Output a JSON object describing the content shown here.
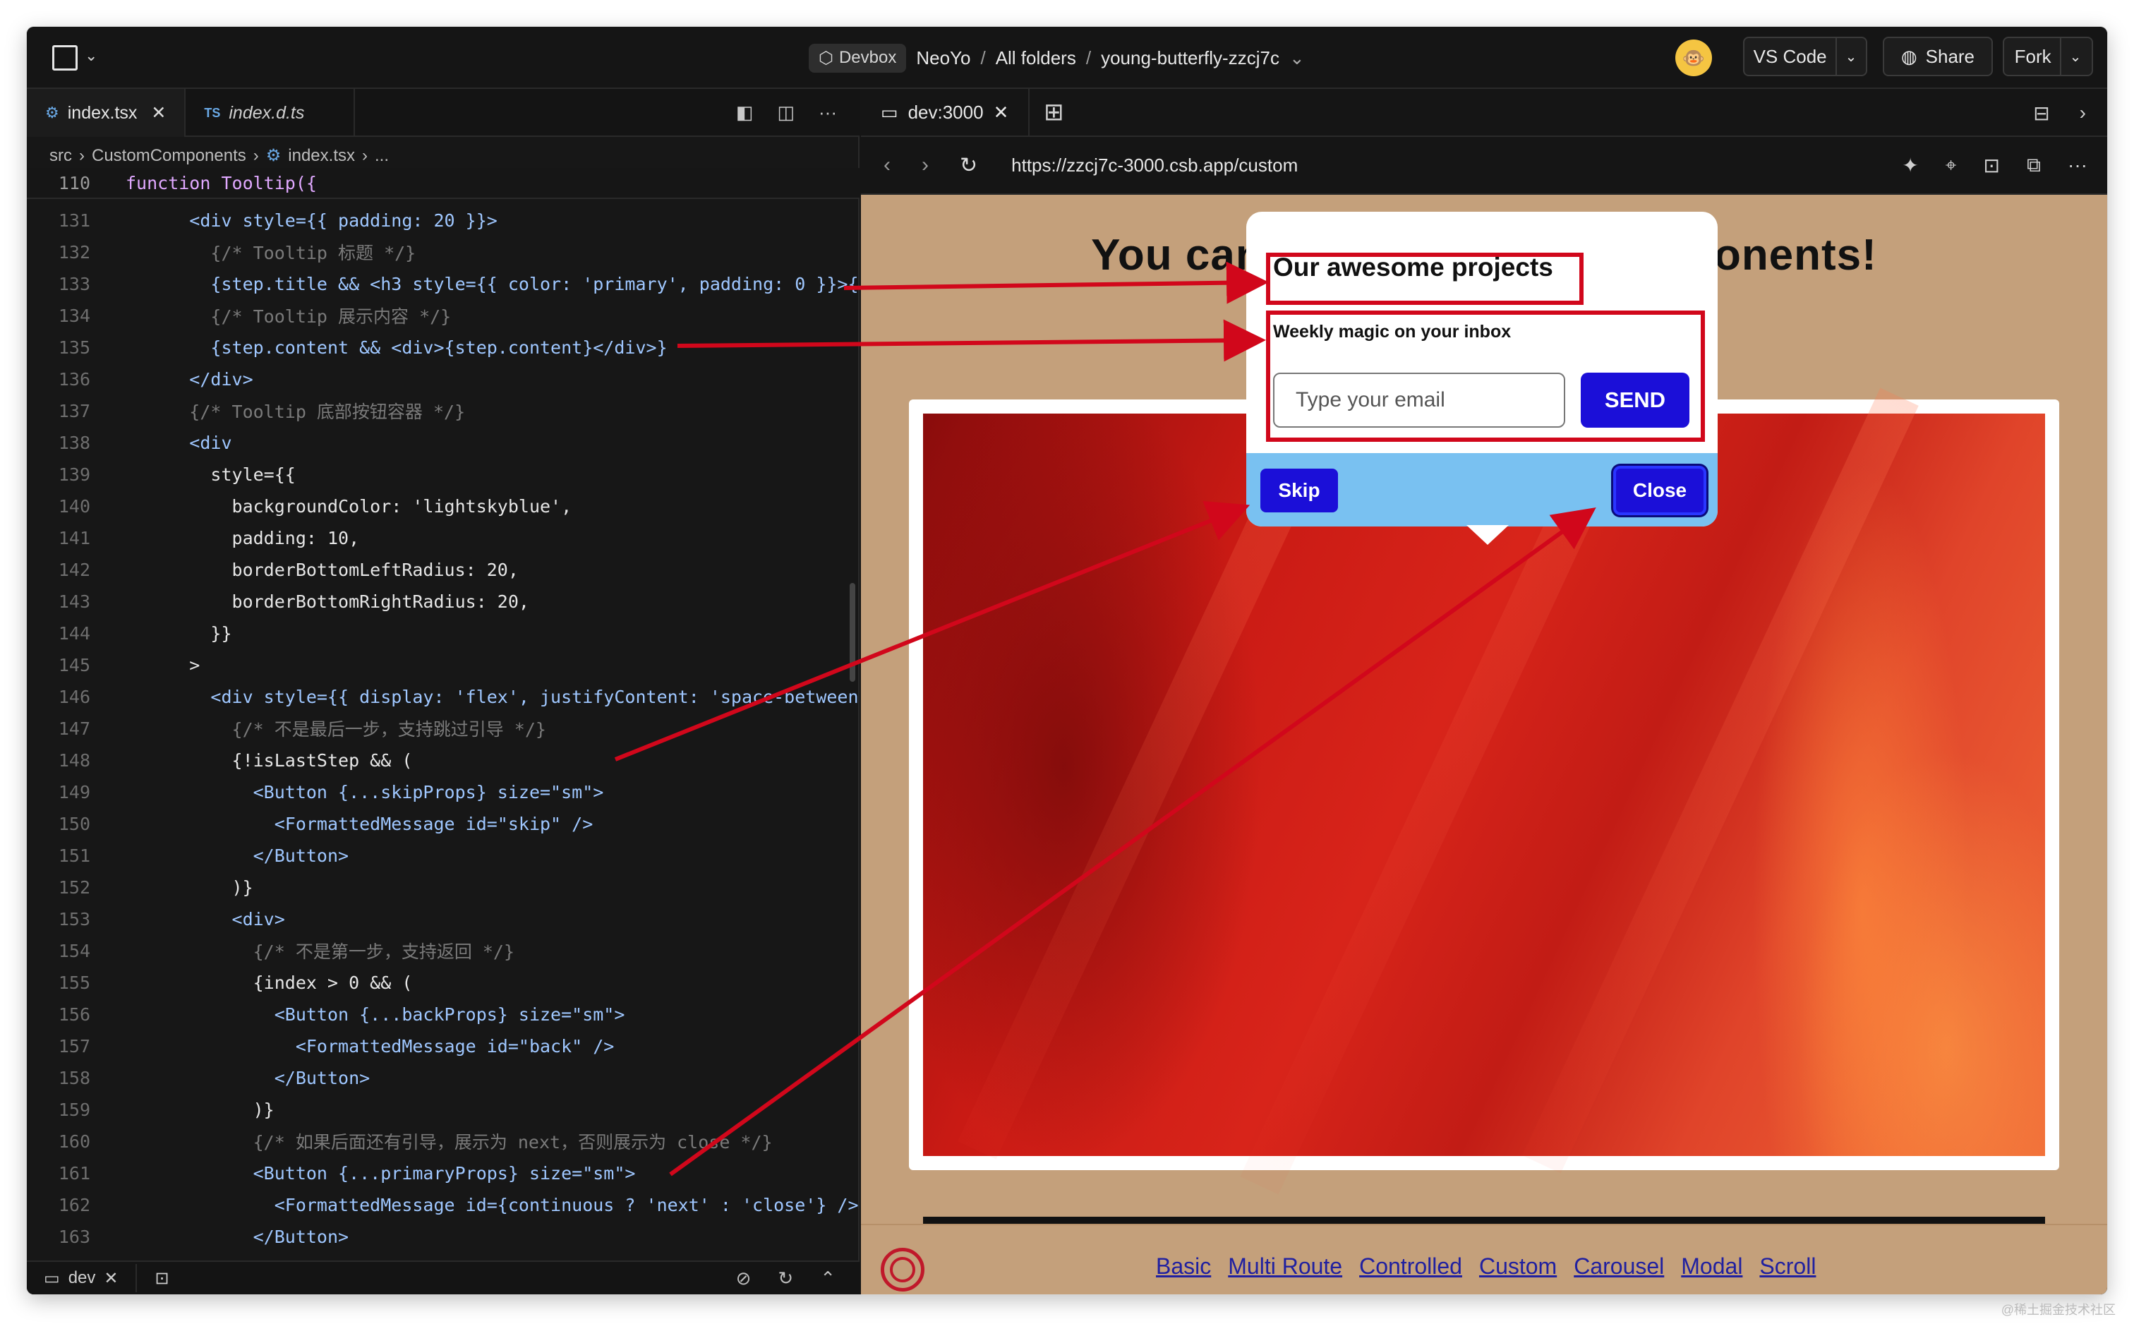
{
  "topbar": {
    "devbox_label": "Devbox",
    "workspace": "NeoYo",
    "folder": "All folders",
    "project": "young-butterfly-zzcj7c",
    "vscode_label": "VS Code",
    "share_label": "Share",
    "fork_label": "Fork"
  },
  "editor": {
    "tabs": [
      {
        "label": "index.tsx",
        "icon": "react-gear-icon"
      },
      {
        "label": "index.d.ts",
        "icon": "ts-icon"
      }
    ],
    "breadcrumb": [
      "src",
      "CustomComponents",
      "index.tsx",
      "..."
    ],
    "sticky_line": {
      "no": "110",
      "text": "function Tooltip({"
    },
    "lines": [
      {
        "no": "131",
        "text": "      <div style={{ padding: 20 }}>"
      },
      {
        "no": "132",
        "text": "        {/* Tooltip 标题 */}"
      },
      {
        "no": "133",
        "text": "        {step.title && <h3 style={{ color: 'primary', padding: 0 }}>{"
      },
      {
        "no": "134",
        "text": "        {/* Tooltip 展示内容 */}"
      },
      {
        "no": "135",
        "text": "        {step.content && <div>{step.content}</div>}"
      },
      {
        "no": "136",
        "text": "      </div>"
      },
      {
        "no": "137",
        "text": "      {/* Tooltip 底部按钮容器 */}"
      },
      {
        "no": "138",
        "text": "      <div"
      },
      {
        "no": "139",
        "text": "        style={{"
      },
      {
        "no": "140",
        "text": "          backgroundColor: 'lightskyblue',"
      },
      {
        "no": "141",
        "text": "          padding: 10,"
      },
      {
        "no": "142",
        "text": "          borderBottomLeftRadius: 20,"
      },
      {
        "no": "143",
        "text": "          borderBottomRightRadius: 20,"
      },
      {
        "no": "144",
        "text": "        }}"
      },
      {
        "no": "145",
        "text": "      >"
      },
      {
        "no": "146",
        "text": "        <div style={{ display: 'flex', justifyContent: 'space-between"
      },
      {
        "no": "147",
        "text": "          {/* 不是最后一步，支持跳过引导 */}"
      },
      {
        "no": "148",
        "text": "          {!isLastStep && ("
      },
      {
        "no": "149",
        "text": "            <Button {...skipProps} size=\"sm\">"
      },
      {
        "no": "150",
        "text": "              <FormattedMessage id=\"skip\" />"
      },
      {
        "no": "151",
        "text": "            </Button>"
      },
      {
        "no": "152",
        "text": "          )}"
      },
      {
        "no": "153",
        "text": "          <div>"
      },
      {
        "no": "154",
        "text": "            {/* 不是第一步，支持返回 */}"
      },
      {
        "no": "155",
        "text": "            {index > 0 && ("
      },
      {
        "no": "156",
        "text": "              <Button {...backProps} size=\"sm\">"
      },
      {
        "no": "157",
        "text": "                <FormattedMessage id=\"back\" />"
      },
      {
        "no": "158",
        "text": "              </Button>"
      },
      {
        "no": "159",
        "text": "            )}"
      },
      {
        "no": "160",
        "text": "            {/* 如果后面还有引导，展示为 next，否则展示为 close */}"
      },
      {
        "no": "161",
        "text": "            <Button {...primaryProps} size=\"sm\">"
      },
      {
        "no": "162",
        "text": "              <FormattedMessage id={continuous ? 'next' : 'close'} />"
      },
      {
        "no": "163",
        "text": "            </Button>"
      }
    ],
    "status_terminal": "dev"
  },
  "preview": {
    "tab_label": "dev:3000",
    "url": "https://zzcj7c-3000.csb.app/custom",
    "headline": "You can create custom components!",
    "tooltip": {
      "title": "Our awesome projects",
      "subtitle": "Weekly magic on your inbox",
      "input_placeholder": "Type your email",
      "send_label": "SEND",
      "skip_label": "Skip",
      "close_label": "Close"
    },
    "nav_links": [
      "Basic",
      "Multi Route",
      "Controlled",
      "Custom",
      "Carousel",
      "Modal",
      "Scroll"
    ]
  },
  "colors": {
    "annotation_red": "#d1071b",
    "button_blue": "#1b0fd8",
    "tooltip_footer": "#79c1f1",
    "site_bg": "#c4a07b"
  },
  "watermark": "@稀土掘金技术社区"
}
